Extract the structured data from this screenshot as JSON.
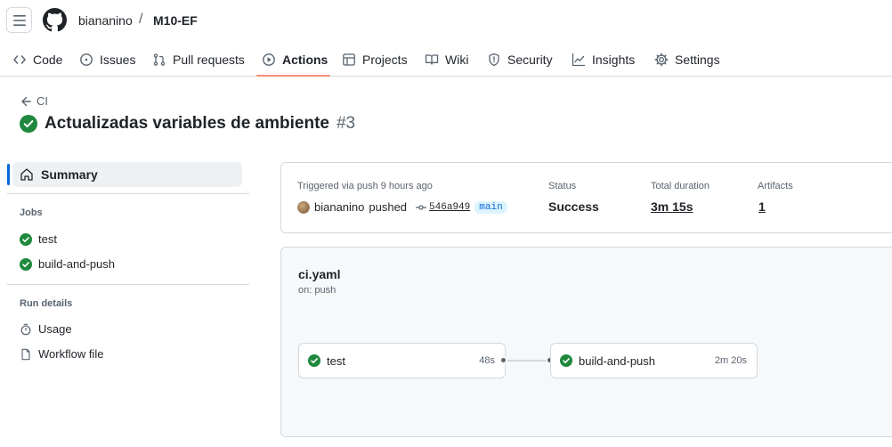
{
  "header": {
    "owner": "biananino",
    "separator": "/",
    "repo": "M10-EF"
  },
  "nav": {
    "tabs": [
      {
        "label": "Code",
        "icon": "code-icon"
      },
      {
        "label": "Issues",
        "icon": "issue-icon"
      },
      {
        "label": "Pull requests",
        "icon": "pull-request-icon"
      },
      {
        "label": "Actions",
        "icon": "play-icon",
        "active": true
      },
      {
        "label": "Projects",
        "icon": "table-icon"
      },
      {
        "label": "Wiki",
        "icon": "book-icon"
      },
      {
        "label": "Security",
        "icon": "shield-icon"
      },
      {
        "label": "Insights",
        "icon": "graph-icon"
      },
      {
        "label": "Settings",
        "icon": "gear-icon"
      }
    ]
  },
  "run": {
    "back_label": "CI",
    "title": "Actualizadas variables de ambiente",
    "number": "#3"
  },
  "sidebar": {
    "summary_label": "Summary",
    "jobs_heading": "Jobs",
    "jobs": [
      {
        "label": "test",
        "status": "success"
      },
      {
        "label": "build-and-push",
        "status": "success"
      }
    ],
    "run_details_heading": "Run details",
    "details": [
      {
        "label": "Usage",
        "icon": "stopwatch-icon"
      },
      {
        "label": "Workflow file",
        "icon": "file-icon"
      }
    ]
  },
  "summary": {
    "trigger_label": "Triggered via push 9 hours ago",
    "actor": "biananino",
    "action": "pushed",
    "commit": "546a949",
    "branch": "main",
    "status_label": "Status",
    "status_value": "Success",
    "duration_label": "Total duration",
    "duration_value": "3m 15s",
    "artifacts_label": "Artifacts",
    "artifacts_value": "1"
  },
  "workflow": {
    "file": "ci.yaml",
    "trigger": "on: push",
    "jobs": [
      {
        "name": "test",
        "duration": "48s",
        "status": "success"
      },
      {
        "name": "build-and-push",
        "duration": "2m 20s",
        "status": "success"
      }
    ]
  },
  "colors": {
    "success": "#1f883d",
    "accent": "#0969da",
    "tab_underline": "#fd8c73",
    "border": "#d1d9e0",
    "muted": "#59636e"
  }
}
